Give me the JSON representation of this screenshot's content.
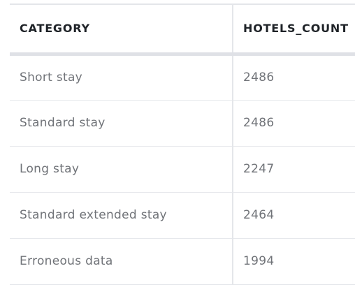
{
  "table": {
    "columns": [
      "CATEGORY",
      "HOTELS_COUNT"
    ],
    "rows": [
      {
        "category": "Short stay",
        "hotels_count": "2486"
      },
      {
        "category": "Standard stay",
        "hotels_count": "2486"
      },
      {
        "category": "Long stay",
        "hotels_count": "2247"
      },
      {
        "category": "Standard extended stay",
        "hotels_count": "2464"
      },
      {
        "category": "Erroneous data",
        "hotels_count": "1994"
      }
    ]
  }
}
